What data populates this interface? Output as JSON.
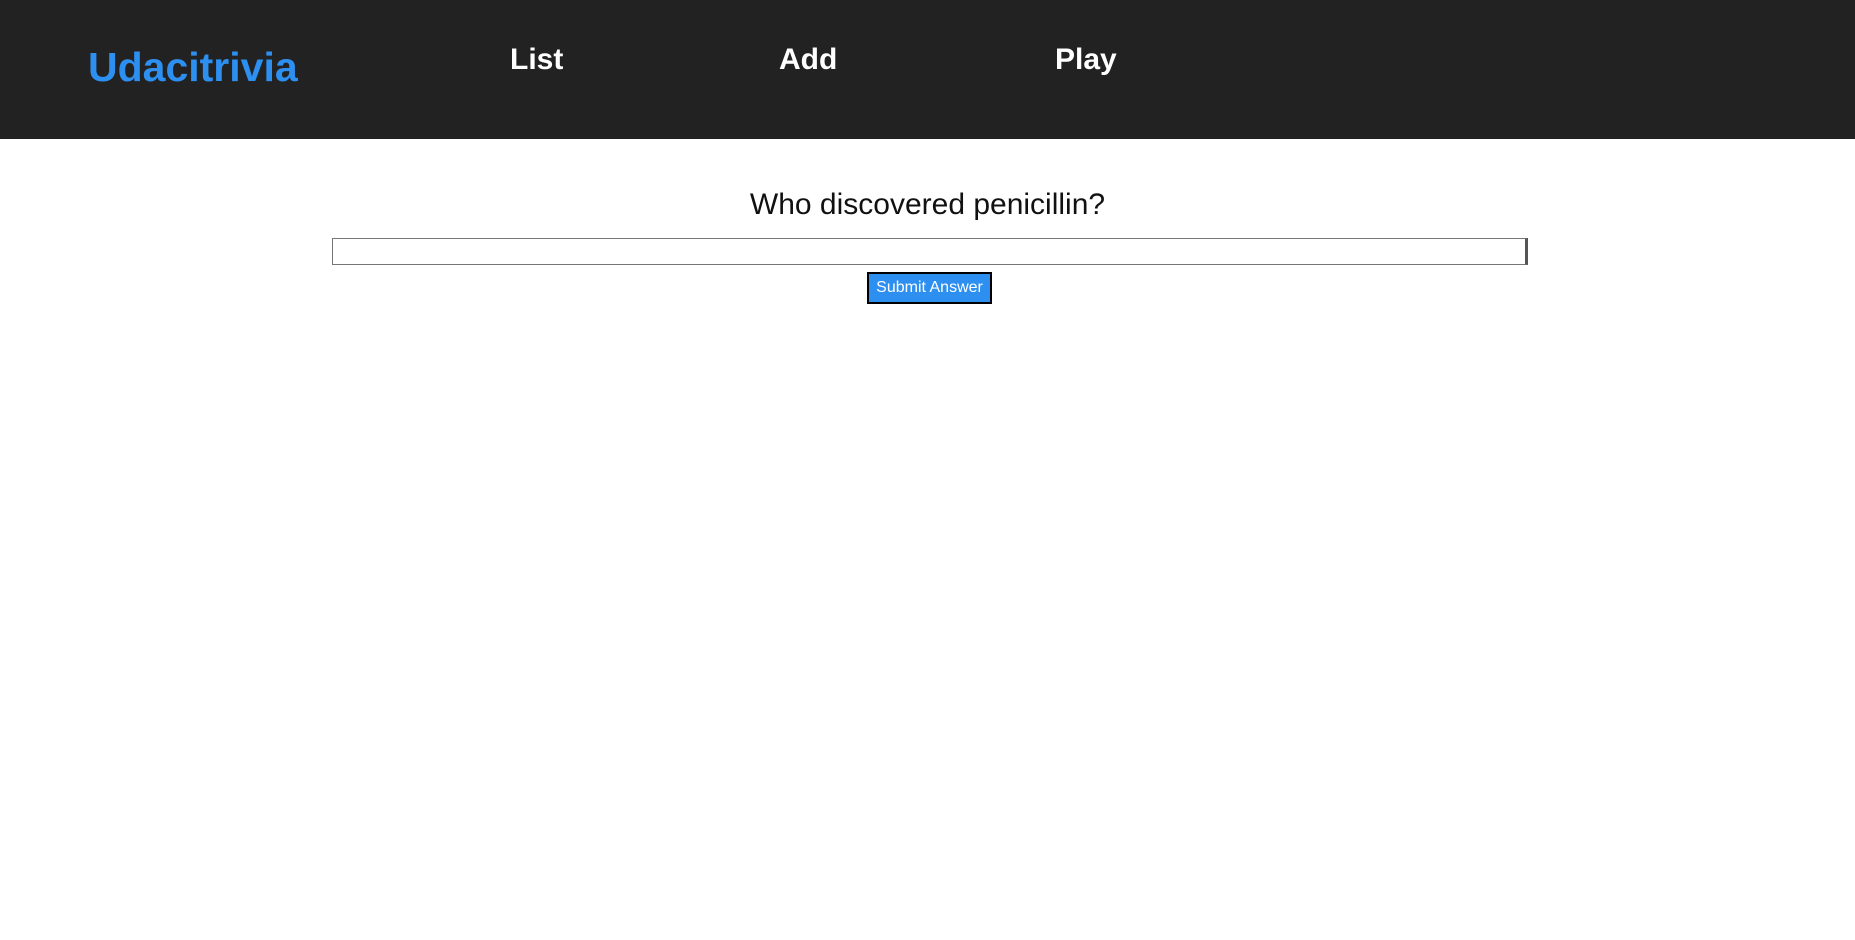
{
  "header": {
    "logo": "Udacitrivia",
    "nav": {
      "list": "List",
      "add": "Add",
      "play": "Play"
    }
  },
  "quiz": {
    "question": "Who discovered penicillin?",
    "answer_value": "",
    "answer_placeholder": "",
    "submit_label": "Submit Answer"
  },
  "colors": {
    "navbar_bg": "#222222",
    "brand_blue": "#2d8ff0",
    "nav_text": "#ffffff",
    "page_bg": "#ffffff"
  }
}
